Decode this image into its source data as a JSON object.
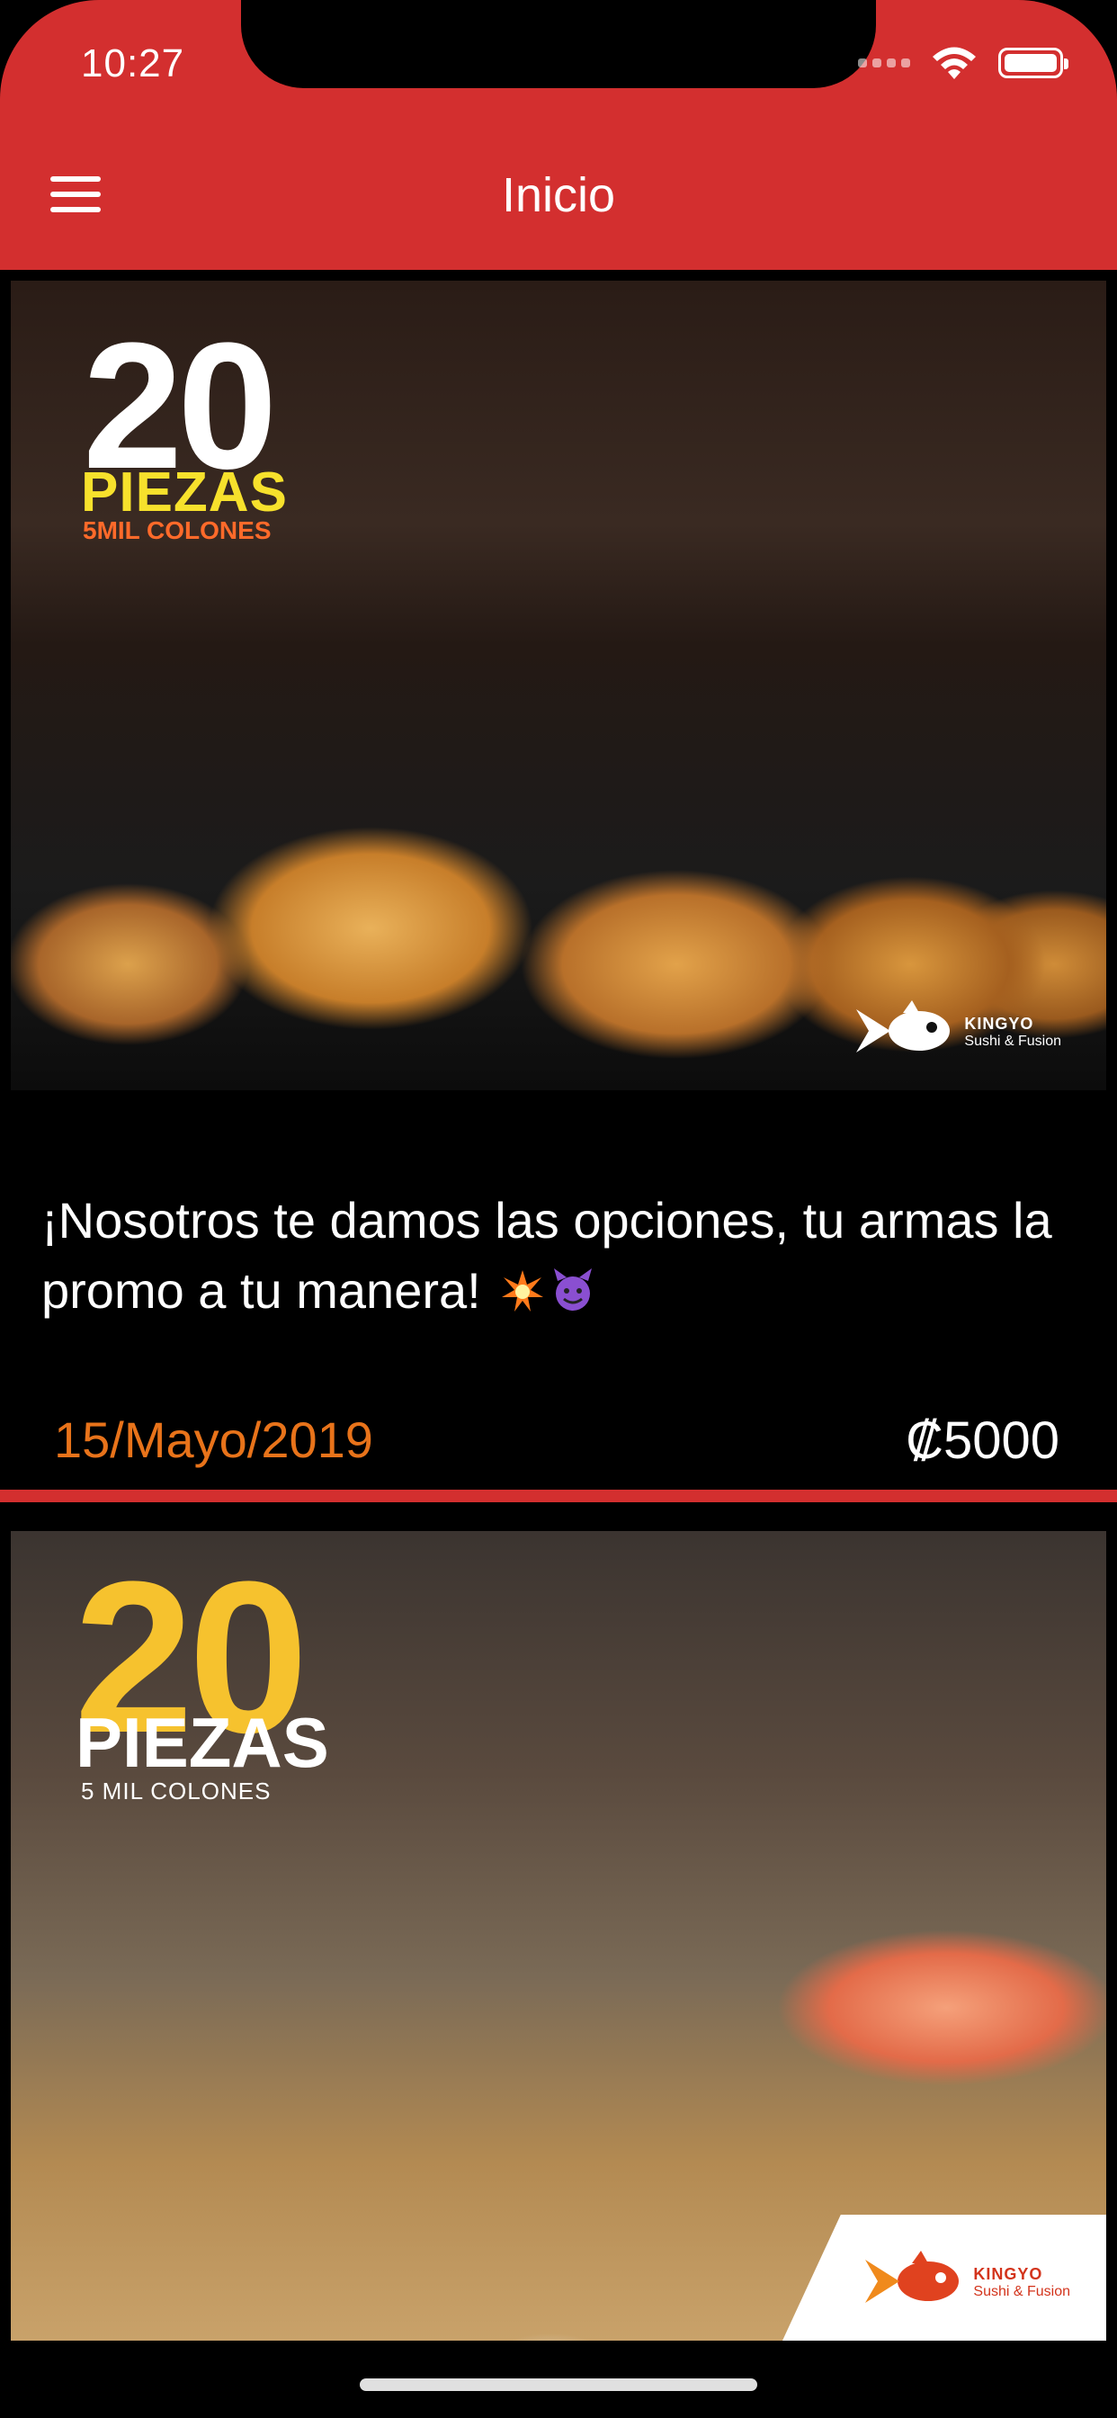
{
  "status_bar": {
    "time": "10:27"
  },
  "header": {
    "title": "Inicio"
  },
  "feed": [
    {
      "promo": {
        "number": "20",
        "label": "PIEZAS",
        "sub": "5MIL COLONES"
      },
      "description": "¡Nosotros te damos las opciones, tu armas la promo a tu manera!",
      "date": "15/Mayo/2019",
      "price": "₡5000",
      "logo": {
        "name": "KINGYO",
        "tagline": "Sushi & Fusion"
      }
    },
    {
      "promo": {
        "number": "20",
        "label": "PIEZAS",
        "sub": "5 MIL COLONES"
      },
      "logo": {
        "name": "KINGYO",
        "tagline": "Sushi & Fusion"
      }
    }
  ],
  "colors": {
    "accent": "#d32f2f",
    "date": "#e8731a",
    "background": "#000000"
  },
  "icons": [
    "menu-icon",
    "signal-icon",
    "wifi-icon",
    "battery-icon"
  ]
}
